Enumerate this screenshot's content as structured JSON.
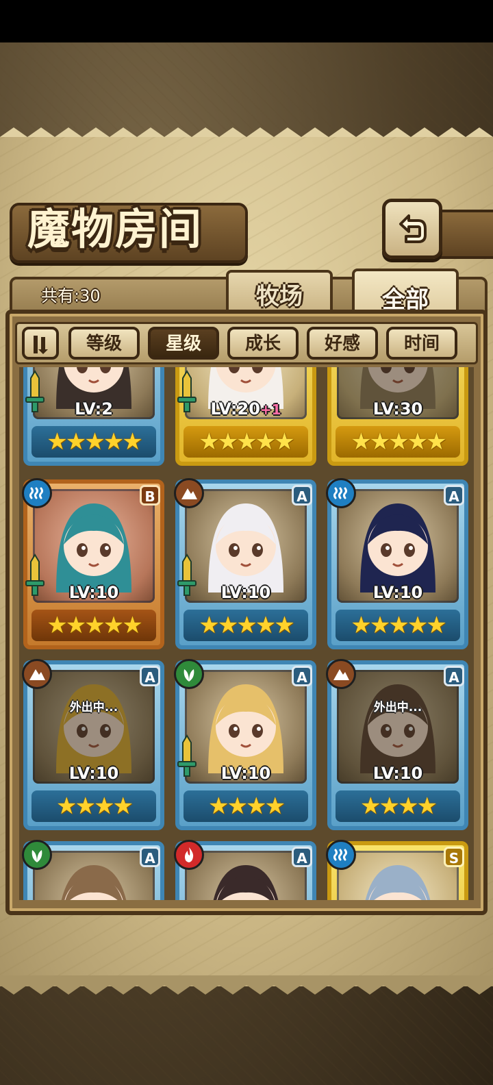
{
  "header": {
    "title": "魔物房间",
    "count_label": "共有:30"
  },
  "tabs": [
    {
      "label": "牧场",
      "active": false
    },
    {
      "label": "全部",
      "active": true
    }
  ],
  "sort_buttons": [
    {
      "label": "等级",
      "active": false
    },
    {
      "label": "星级",
      "active": true
    },
    {
      "label": "成长",
      "active": false
    },
    {
      "label": "好感",
      "active": false
    },
    {
      "label": "时间",
      "active": false
    }
  ],
  "away_label": "外出中...",
  "monsters": [
    {
      "frame": "blue",
      "element": "",
      "rank": "",
      "level": "LV:2",
      "level_bonus": "",
      "stars": "★★★★★",
      "away": false,
      "equipped": true,
      "icon": "dark-hair-girl-portrait"
    },
    {
      "frame": "gold",
      "element": "",
      "rank": "",
      "level": "LV:20",
      "level_bonus": "+1",
      "stars": "★★★★★",
      "away": false,
      "equipped": true,
      "icon": "sheep-girl-glasses-portrait"
    },
    {
      "frame": "gold",
      "element": "",
      "rank": "",
      "level": "LV:30",
      "level_bonus": "",
      "stars": "★★★★★",
      "away": true,
      "equipped": false,
      "icon": "mummy-portrait"
    },
    {
      "frame": "bronze",
      "element": "water",
      "rank": "B",
      "level": "LV:10",
      "level_bonus": "",
      "stars": "★★★★★",
      "away": false,
      "equipped": true,
      "icon": "horned-teal-hair-girl-portrait"
    },
    {
      "frame": "blue",
      "element": "earth",
      "rank": "A",
      "level": "LV:10",
      "level_bonus": "",
      "stars": "★★★★★",
      "away": false,
      "equipped": true,
      "icon": "white-sheep-girl-portrait"
    },
    {
      "frame": "blue",
      "element": "water",
      "rank": "A",
      "level": "LV:10",
      "level_bonus": "",
      "stars": "★★★★★",
      "away": false,
      "equipped": false,
      "icon": "navy-hair-girl-portrait"
    },
    {
      "frame": "blue",
      "element": "earth",
      "rank": "A",
      "level": "LV:10",
      "level_bonus": "",
      "stars": "★★★★",
      "away": true,
      "equipped": false,
      "icon": "blonde-armored-girl-portrait"
    },
    {
      "frame": "blue",
      "element": "wood",
      "rank": "A",
      "level": "LV:10",
      "level_bonus": "",
      "stars": "★★★★",
      "away": false,
      "equipped": true,
      "icon": "blonde-girl-staff-portrait"
    },
    {
      "frame": "blue",
      "element": "earth",
      "rank": "A",
      "level": "LV:10",
      "level_bonus": "",
      "stars": "★★★★",
      "away": true,
      "equipped": false,
      "icon": "dark-skin-girl-portrait"
    },
    {
      "frame": "blue",
      "element": "wood",
      "rank": "A",
      "level": "",
      "level_bonus": "",
      "stars": "",
      "away": false,
      "equipped": false,
      "icon": "owl-portrait"
    },
    {
      "frame": "blue",
      "element": "fire",
      "rank": "A",
      "level": "",
      "level_bonus": "",
      "stars": "",
      "away": false,
      "equipped": false,
      "icon": "dark-creature-portrait"
    },
    {
      "frame": "gold",
      "element": "water",
      "rank": "S",
      "level": "",
      "level_bonus": "",
      "stars": "",
      "away": false,
      "equipped": false,
      "icon": "silver-hair-girl-portrait"
    }
  ],
  "colors": {
    "parchment": "#d9c89a",
    "frame_dark": "#3b2712",
    "blue_frame": "#3f86b4",
    "gold_frame": "#c99a12",
    "bronze_frame": "#b2631c",
    "star": "#ffd22b",
    "level_bonus": "#ff6fa8"
  }
}
